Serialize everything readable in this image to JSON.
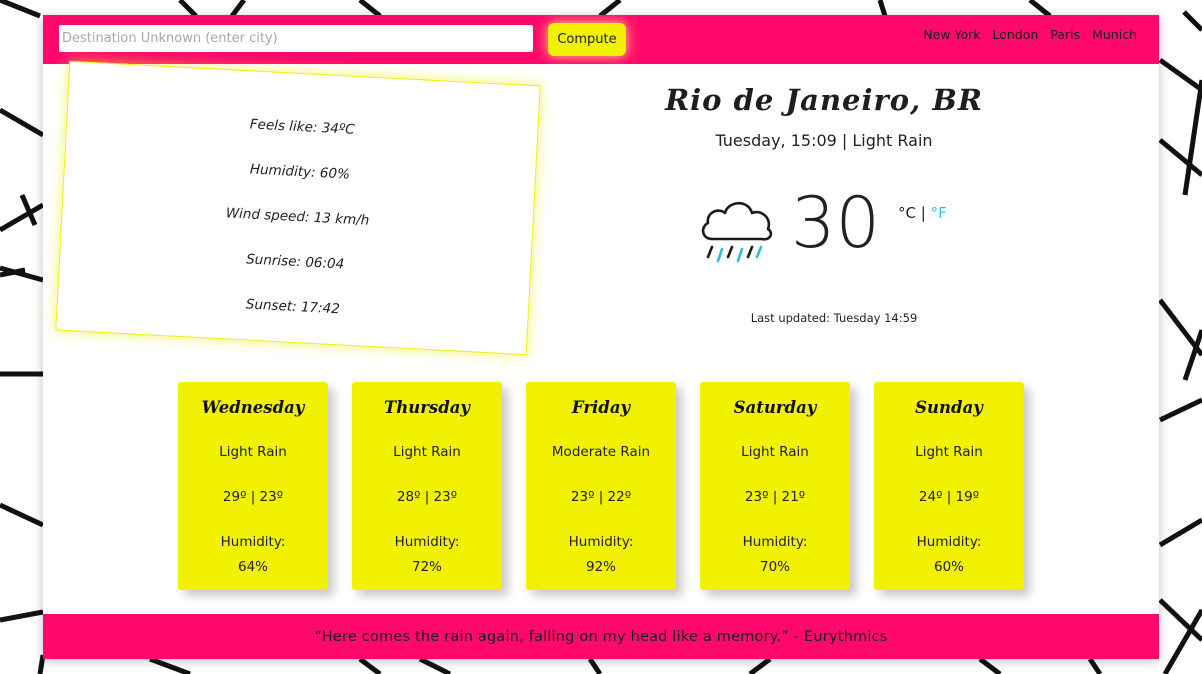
{
  "search": {
    "placeholder": "Destination Unknown (enter city)",
    "value": "",
    "button_label": "Compute"
  },
  "nav": {
    "cities": [
      "New York",
      "London",
      "Paris",
      "Munich"
    ]
  },
  "current": {
    "city": "Rio de Janeiro, BR",
    "date_line": "Tuesday, 15:09 | Light Rain",
    "temperature": "30",
    "unit_c": "°C",
    "unit_sep": "|",
    "unit_f": "°F",
    "last_updated": "Last updated: Tuesday 14:59",
    "icon": "rain-cloud-icon"
  },
  "details": {
    "feels_like": "Feels like: 34ºC",
    "humidity": "Humidity: 60%",
    "wind": "Wind speed: 13 km/h",
    "sunrise": "Sunrise: 06:04",
    "sunset": "Sunset: 17:42"
  },
  "forecast": [
    {
      "day": "Wednesday",
      "desc": "Light Rain",
      "temps": "29º | 23º",
      "humidity_label": "Humidity:",
      "humidity": "64%"
    },
    {
      "day": "Thursday",
      "desc": "Light Rain",
      "temps": "28º | 23º",
      "humidity_label": "Humidity:",
      "humidity": "72%"
    },
    {
      "day": "Friday",
      "desc": "Moderate Rain",
      "temps": "23º | 22º",
      "humidity_label": "Humidity:",
      "humidity": "92%"
    },
    {
      "day": "Saturday",
      "desc": "Light Rain",
      "temps": "23º | 21º",
      "humidity_label": "Humidity:",
      "humidity": "70%"
    },
    {
      "day": "Sunday",
      "desc": "Light Rain",
      "temps": "24º | 19º",
      "humidity_label": "Humidity:",
      "humidity": "60%"
    }
  ],
  "footer": {
    "quote": "“Here comes the rain again, falling on my head like a memory.” - Eurythmics"
  },
  "colors": {
    "accent_pink": "#ff0a6c",
    "accent_yellow": "#f2f200",
    "link_cyan": "#27c4d9"
  }
}
